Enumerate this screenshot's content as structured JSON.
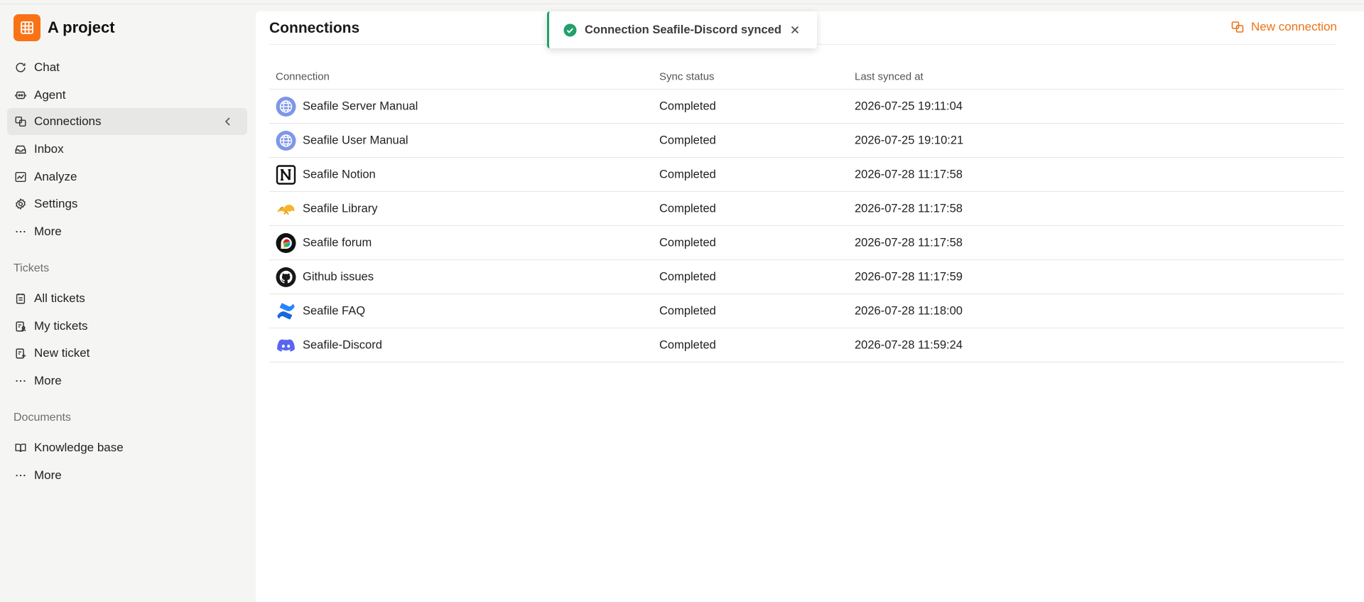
{
  "app": {
    "project_name": "A project"
  },
  "sidebar": {
    "main_items": [
      {
        "label": "Chat",
        "icon": "chat-icon"
      },
      {
        "label": "Agent",
        "icon": "agent-icon"
      },
      {
        "label": "Connections",
        "icon": "connections-icon",
        "active": true
      },
      {
        "label": "Inbox",
        "icon": "inbox-icon"
      },
      {
        "label": "Analyze",
        "icon": "analyze-icon"
      },
      {
        "label": "Settings",
        "icon": "gear-icon"
      },
      {
        "label": "More",
        "icon": "more-icon"
      }
    ],
    "tickets": {
      "label": "Tickets",
      "items": [
        {
          "label": "All tickets",
          "icon": "all-tickets-icon"
        },
        {
          "label": "My tickets",
          "icon": "my-tickets-icon"
        },
        {
          "label": "New ticket",
          "icon": "new-ticket-icon"
        },
        {
          "label": "More",
          "icon": "more-icon"
        }
      ]
    },
    "documents": {
      "label": "Documents",
      "items": [
        {
          "label": "Knowledge base",
          "icon": "book-icon"
        },
        {
          "label": "More",
          "icon": "more-icon"
        }
      ]
    }
  },
  "main": {
    "title": "Connections",
    "new_connection_label": "New connection",
    "accent_color": "#ea7418",
    "columns": [
      "Connection",
      "Sync status",
      "Last synced at"
    ],
    "rows": [
      {
        "name": "Seafile Server Manual",
        "icon": "globe-icon",
        "status": "Completed",
        "synced_at": "2026-07-25 19:11:04"
      },
      {
        "name": "Seafile User Manual",
        "icon": "globe-icon",
        "status": "Completed",
        "synced_at": "2026-07-25 19:10:21"
      },
      {
        "name": "Seafile Notion",
        "icon": "notion-icon",
        "status": "Completed",
        "synced_at": "2026-07-28 11:17:58"
      },
      {
        "name": "Seafile Library",
        "icon": "seafile-icon",
        "status": "Completed",
        "synced_at": "2026-07-28 11:17:58"
      },
      {
        "name": "Seafile forum",
        "icon": "discourse-icon",
        "status": "Completed",
        "synced_at": "2026-07-28 11:17:58"
      },
      {
        "name": "Github issues",
        "icon": "github-icon",
        "status": "Completed",
        "synced_at": "2026-07-28 11:17:59"
      },
      {
        "name": "Seafile FAQ",
        "icon": "confluence-icon",
        "status": "Completed",
        "synced_at": "2026-07-28 11:18:00"
      },
      {
        "name": "Seafile-Discord",
        "icon": "discord-icon",
        "status": "Completed",
        "synced_at": "2026-07-28 11:59:24"
      }
    ]
  },
  "toast": {
    "message": "Connection Seafile-Discord synced",
    "status_color": "#22a06b"
  }
}
